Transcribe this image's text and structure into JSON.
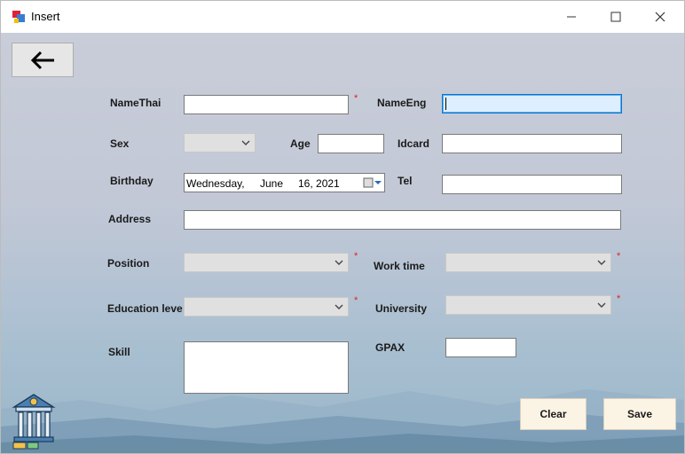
{
  "window": {
    "title": "Insert",
    "app_icon": "form-app-icon",
    "controls": [
      "minimize-icon",
      "maximize-icon",
      "close-icon"
    ]
  },
  "toolbar": {
    "back_icon": "arrow-left-icon"
  },
  "form": {
    "name_thai": {
      "label": "NameThai",
      "value": ""
    },
    "name_eng": {
      "label": "NameEng",
      "value": ""
    },
    "sex": {
      "label": "Sex",
      "value": ""
    },
    "age": {
      "label": "Age",
      "value": ""
    },
    "idcard": {
      "label": "Idcard",
      "value": ""
    },
    "birthday": {
      "label": "Birthday",
      "day": "Wednesday,",
      "month": "June",
      "date": "16, 2021"
    },
    "tel": {
      "label": "Tel",
      "value": ""
    },
    "address": {
      "label": "Address",
      "value": ""
    },
    "position": {
      "label": "Position",
      "value": ""
    },
    "work_time": {
      "label": "Work time",
      "value": ""
    },
    "education_level": {
      "label": "Education leve",
      "value": ""
    },
    "university": {
      "label": "University",
      "value": ""
    },
    "skill": {
      "label": "Skill",
      "value": ""
    },
    "gpax": {
      "label": "GPAX",
      "value": ""
    },
    "required_mark": "*"
  },
  "actions": {
    "clear_label": "Clear",
    "save_label": "Save"
  },
  "decor": {
    "logo_icon": "bank-building-icon"
  },
  "colors": {
    "focus_border": "#0078d7",
    "required": "#e02020",
    "button_bg": "#fbf3e4"
  }
}
